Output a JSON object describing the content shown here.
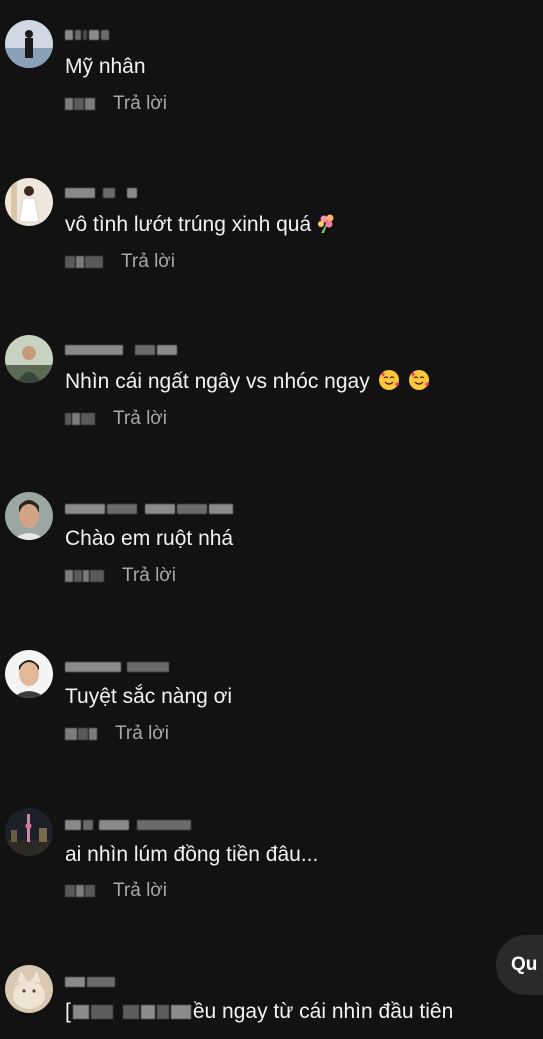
{
  "reply_label": "Trả lời",
  "floating_button_label": "Qu",
  "comments": [
    {
      "avatar": "man-standing-photo-avatar",
      "text": "Mỹ nhân",
      "emoji": []
    },
    {
      "avatar": "girl-white-dress-avatar",
      "text": "vô tình lướt trúng xinh quá",
      "emoji": [
        "bouquet-emoji"
      ]
    },
    {
      "avatar": "man-outdoor-avatar",
      "text": "Nhìn cái ngất ngây vs nhóc ngay",
      "emoji": [
        "smiling-face-with-hearts-emoji",
        "smiling-face-with-hearts-emoji"
      ]
    },
    {
      "avatar": "young-man-selfie-avatar",
      "text": "Chào em ruột nhá",
      "emoji": []
    },
    {
      "avatar": "boy-portrait-avatar",
      "text": "Tuyệt sắc nàng ơi",
      "emoji": []
    },
    {
      "avatar": "city-night-avatar",
      "text": "ai nhìn lúm đồng tiền đâu...",
      "emoji": []
    },
    {
      "avatar": "cat-avatar",
      "text_prefix": "[",
      "text_suffix": "ều ngay từ cái nhìn đầu tiên",
      "emoji": []
    }
  ]
}
